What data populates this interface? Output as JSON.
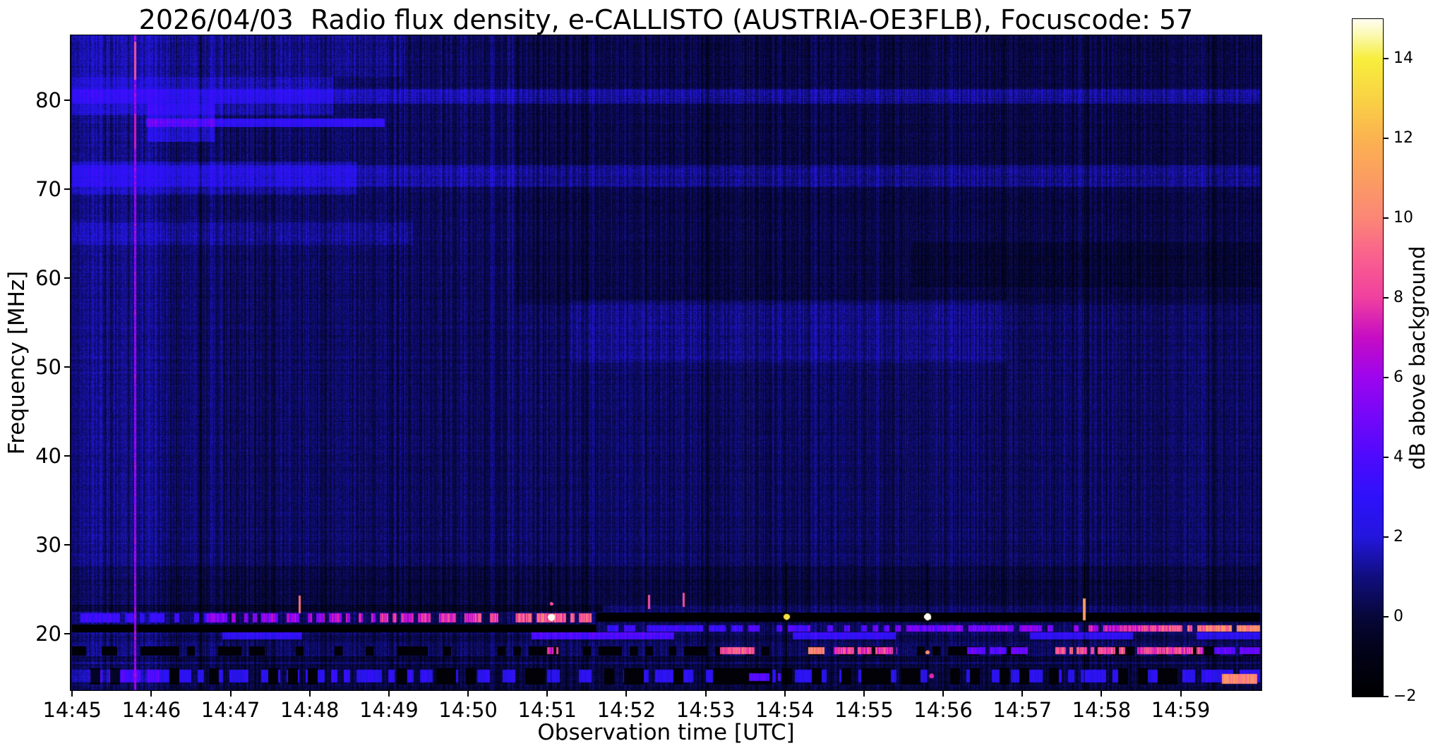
{
  "chart_data": {
    "type": "heatmap",
    "subtype": "radio-spectrogram",
    "title": "2026/04/03  Radio flux density, e-CALLISTO (AUSTRIA-OE3FLB), Focuscode: 57",
    "xlabel": "Observation time [UTC]",
    "ylabel": "Frequency [MHz]",
    "x_ticks": [
      "14:45",
      "14:46",
      "14:47",
      "14:48",
      "14:49",
      "14:50",
      "14:51",
      "14:52",
      "14:53",
      "14:54",
      "14:55",
      "14:56",
      "14:57",
      "14:58",
      "14:59"
    ],
    "x_tick_minutes": [
      0,
      1,
      2,
      3,
      4,
      5,
      6,
      7,
      8,
      9,
      10,
      11,
      12,
      13,
      14
    ],
    "time_range_min": [
      -0.02,
      15.02
    ],
    "y_ticks": [
      20,
      30,
      40,
      50,
      60,
      70,
      80
    ],
    "freq_range_mhz": [
      13.66,
      87.3
    ],
    "grid": false,
    "colorbar": {
      "label": "dB above background",
      "tick_values": [
        14,
        12,
        10,
        8,
        6,
        4,
        2,
        0,
        -2
      ],
      "tick_labels": [
        "14",
        "12",
        "10",
        "8",
        "6",
        "4",
        "2",
        "0",
        "−2"
      ],
      "value_range": [
        -2,
        15
      ],
      "colormap": [
        [
          -2,
          "#000000"
        ],
        [
          -0.7,
          "#03031e"
        ],
        [
          0,
          "#07073a"
        ],
        [
          1,
          "#100e7e"
        ],
        [
          2,
          "#2316dd"
        ],
        [
          3,
          "#2e11fa"
        ],
        [
          4,
          "#4d0afd"
        ],
        [
          5,
          "#7407f9"
        ],
        [
          6,
          "#9d05ee"
        ],
        [
          7,
          "#c50cc4"
        ],
        [
          8,
          "#f0409f"
        ],
        [
          9,
          "#f95f8f"
        ],
        [
          10,
          "#fb8676"
        ],
        [
          11,
          "#fb9d62"
        ],
        [
          12,
          "#fbb250"
        ],
        [
          13,
          "#f9d244"
        ],
        [
          14,
          "#f7ee3c"
        ],
        [
          14.6,
          "#fbf9b0"
        ],
        [
          15,
          "#fffef2"
        ]
      ]
    },
    "noise": {
      "base_db": 0.5,
      "column_jitter": 0.75,
      "pixel_jitter": 0.55,
      "row_jitter": 0.25
    },
    "regions": [
      {
        "t": [
          0,
          15
        ],
        "f": [
          79.6,
          81.3
        ],
        "dv": 1.1
      },
      {
        "t": [
          0,
          3.3
        ],
        "f": [
          78.3,
          82.6
        ],
        "dv": 1.0
      },
      {
        "t": [
          0,
          4.2
        ],
        "f": [
          82.6,
          87.3
        ],
        "dv": 0.45
      },
      {
        "t": [
          0.93,
          3.95
        ],
        "f": [
          77.0,
          77.9
        ],
        "dv": 2.3
      },
      {
        "t": [
          0.95,
          1.8
        ],
        "f": [
          75.3,
          79.6
        ],
        "dv": 1.3
      },
      {
        "t": [
          0,
          15
        ],
        "f": [
          70.2,
          72.7
        ],
        "dv": 0.95
      },
      {
        "t": [
          0,
          3.6
        ],
        "f": [
          69.4,
          73.1
        ],
        "dv": 0.8
      },
      {
        "t": [
          0,
          4.3
        ],
        "f": [
          63.7,
          66.3
        ],
        "dv": 0.55
      },
      {
        "t": [
          5.6,
          15
        ],
        "f": [
          57,
          87.3
        ],
        "dv": -0.4
      },
      {
        "t": [
          10.6,
          15
        ],
        "f": [
          59,
          64
        ],
        "dv": -0.35
      },
      {
        "t": [
          6.3,
          11.8
        ],
        "f": [
          50.5,
          57.5
        ],
        "dv": 0.5
      },
      {
        "t": [
          0,
          15
        ],
        "f": [
          23.2,
          27.6
        ],
        "dv": -0.55
      },
      {
        "t": [
          0,
          15
        ],
        "f": [
          13.66,
          16.6
        ],
        "dv": -0.55
      },
      {
        "t": [
          0,
          15
        ],
        "f": [
          16.8,
          17.45
        ],
        "dv": -0.75
      },
      {
        "t": [
          0,
          1.15
        ],
        "f": [
          13.66,
          87.3
        ],
        "dv": 0.45
      },
      {
        "t": [
          0,
          6.7
        ],
        "f": [
          22.45,
          23.3
        ],
        "dv": -1.1
      },
      {
        "t": [
          0,
          15
        ],
        "f": [
          19.1,
          19.9
        ],
        "dv": -0.35
      }
    ],
    "features": [
      {
        "type": "vline",
        "t": 1.62,
        "f": [
          13.66,
          87.3
        ],
        "add": -0.85,
        "w": 2
      },
      {
        "type": "vline",
        "t": 4.83,
        "f": [
          13.66,
          87.3
        ],
        "add": -0.85,
        "w": 2
      },
      {
        "type": "vline",
        "t": 8.03,
        "f": [
          13.66,
          87.3
        ],
        "add": -0.85,
        "w": 2
      },
      {
        "type": "vline",
        "t": 11.23,
        "f": [
          13.66,
          87.3
        ],
        "add": -0.85,
        "w": 2
      },
      {
        "type": "vline",
        "t": 14.43,
        "f": [
          13.66,
          87.3
        ],
        "add": -0.85,
        "w": 2
      },
      {
        "type": "hband",
        "t": [
          0,
          1.7
        ],
        "f": [
          21.3,
          22.3
        ],
        "v": 3.4,
        "dash": 7,
        "duty": 0.6,
        "jitter": 0.8
      },
      {
        "type": "hband",
        "t": [
          1.7,
          6.6
        ],
        "f": [
          21.3,
          22.3
        ],
        "v": 5,
        "v2": 9.3,
        "dash": 6,
        "duty": 0.68,
        "jitter": 1.6
      },
      {
        "type": "hband",
        "t": [
          6.62,
          15
        ],
        "f": [
          21.35,
          22.35
        ],
        "v": -1.85
      },
      {
        "type": "hband",
        "t": [
          0,
          6.62
        ],
        "f": [
          20.15,
          21.05
        ],
        "v": -1.85
      },
      {
        "type": "hband",
        "t": [
          6.75,
          12.6
        ],
        "f": [
          20.25,
          21.0
        ],
        "v": 3,
        "v2": 5.5,
        "dash": 8,
        "duty": 0.72,
        "jitter": 1.2
      },
      {
        "type": "hband",
        "t": [
          12.6,
          15
        ],
        "f": [
          20.25,
          21.0
        ],
        "v": 6,
        "v2": 10.8,
        "dash": 7,
        "duty": 0.78,
        "jitter": 1.5
      },
      {
        "type": "hband",
        "t": [
          1.9,
          2.9
        ],
        "f": [
          19.4,
          20.15
        ],
        "add": 2.6
      },
      {
        "type": "hband",
        "t": [
          5.8,
          7.6
        ],
        "f": [
          19.4,
          20.15
        ],
        "add": 3.6
      },
      {
        "type": "hband",
        "t": [
          9.1,
          10.4
        ],
        "f": [
          19.4,
          20.15
        ],
        "add": 2.8
      },
      {
        "type": "hband",
        "t": [
          12.1,
          13.4
        ],
        "f": [
          19.4,
          20.15
        ],
        "add": 2.6
      },
      {
        "type": "hband",
        "t": [
          14.2,
          15
        ],
        "f": [
          19.4,
          20.15
        ],
        "add": 2.4
      },
      {
        "type": "hband",
        "t": [
          0,
          15
        ],
        "f": [
          17.55,
          18.55
        ],
        "v": -1.7,
        "dash": 11,
        "duty": 0.5
      },
      {
        "type": "hband",
        "t": [
          6.0,
          6.14
        ],
        "f": [
          17.7,
          18.5
        ],
        "v": 8,
        "dash": 4,
        "duty": 0.9,
        "jitter": 1
      },
      {
        "type": "hband",
        "t": [
          8.15,
          8.62
        ],
        "f": [
          17.7,
          18.5
        ],
        "v": 8.5,
        "dash": 5,
        "duty": 0.85,
        "jitter": 1.4
      },
      {
        "type": "hband",
        "t": [
          9.3,
          9.5
        ],
        "f": [
          17.7,
          18.5
        ],
        "v": 10,
        "dash": 5,
        "duty": 0.85,
        "jitter": 1.2
      },
      {
        "type": "hband",
        "t": [
          9.62,
          10.42
        ],
        "f": [
          17.7,
          18.5
        ],
        "v": 8,
        "dash": 5,
        "duty": 0.8,
        "jitter": 1.4
      },
      {
        "type": "hband",
        "t": [
          11.3,
          12.1
        ],
        "f": [
          17.7,
          18.5
        ],
        "v": 4.5,
        "dash": 6,
        "duty": 0.8,
        "jitter": 1
      },
      {
        "type": "hband",
        "t": [
          12.35,
          13.3
        ],
        "f": [
          17.7,
          18.5
        ],
        "v": 8.6,
        "dash": 5,
        "duty": 0.85,
        "jitter": 1.4
      },
      {
        "type": "hband",
        "t": [
          13.45,
          14.3
        ],
        "f": [
          17.7,
          18.5
        ],
        "v": 8.0,
        "dash": 5,
        "duty": 0.8,
        "jitter": 1.4
      },
      {
        "type": "hband",
        "t": [
          14.4,
          15
        ],
        "f": [
          17.7,
          18.5
        ],
        "v": 4.5,
        "dash": 6,
        "duty": 0.8,
        "jitter": 1
      },
      {
        "type": "hband",
        "t": [
          0,
          15
        ],
        "f": [
          14.55,
          15.95
        ],
        "v": 2.7,
        "dash": 9,
        "duty": 0.6,
        "jitter": 0.8
      },
      {
        "type": "hband",
        "t": [
          0,
          15
        ],
        "f": [
          14.3,
          16.1
        ],
        "v": -1.7,
        "dash": 14,
        "duty": 0.33
      },
      {
        "type": "hband",
        "t": [
          0,
          1.1
        ],
        "f": [
          14.5,
          16.0
        ],
        "add": 1.2
      },
      {
        "type": "hband",
        "t": [
          8.55,
          8.95
        ],
        "f": [
          14.7,
          15.6
        ],
        "v": 4.2,
        "dash": 6,
        "duty": 0.7,
        "jitter": 0.8
      },
      {
        "type": "hband",
        "t": [
          14.52,
          14.97
        ],
        "f": [
          14.35,
          15.45
        ],
        "v": 10.3,
        "dash": 5,
        "duty": 0.9,
        "jitter": 1
      },
      {
        "type": "dot",
        "t": 10.85,
        "f": 15.3,
        "r": 3.5,
        "v": 7.5
      },
      {
        "type": "vline",
        "t": 2.87,
        "f": [
          22.3,
          24.3
        ],
        "v": 9.5,
        "w": 3
      },
      {
        "type": "vline",
        "t": 7.28,
        "f": [
          22.8,
          24.4
        ],
        "v": 8.5,
        "w": 3
      },
      {
        "type": "vline",
        "t": 7.72,
        "f": [
          23.0,
          24.6
        ],
        "v": 8.5,
        "w": 3
      },
      {
        "type": "vline",
        "t": 0.79,
        "f": [
          13.66,
          87.3
        ],
        "v": 6.0,
        "w": 3,
        "jitter": 1.2
      },
      {
        "type": "vline",
        "t": 0.79,
        "f": [
          82.3,
          86.6
        ],
        "v": 8.6,
        "w": 3
      },
      {
        "type": "vline",
        "t": 0.79,
        "f": [
          74.5,
          78.5
        ],
        "v": 7.3,
        "w": 3
      },
      {
        "type": "vline",
        "t": 6.05,
        "f": [
          13.66,
          28
        ],
        "add": -1.6,
        "w": 2
      },
      {
        "type": "vline",
        "t": 9.02,
        "f": [
          13.66,
          28
        ],
        "add": -1.6,
        "w": 2
      },
      {
        "type": "vline",
        "t": 10.8,
        "f": [
          13.66,
          28
        ],
        "add": -1.6,
        "w": 2
      },
      {
        "type": "vline",
        "t": 12.78,
        "f": [
          13.66,
          28
        ],
        "add": -1.3,
        "w": 2
      },
      {
        "type": "vline",
        "t": 12.78,
        "f": [
          21.5,
          24.0
        ],
        "v": 11,
        "w": 4
      },
      {
        "type": "dot",
        "t": 6.05,
        "f": 21.9,
        "r": 5,
        "v": 15
      },
      {
        "type": "dot",
        "t": 6.05,
        "f": 23.4,
        "r": 2.5,
        "v": 8.5
      },
      {
        "type": "dot",
        "t": 9.02,
        "f": 21.95,
        "r": 4.5,
        "v": 13.5
      },
      {
        "type": "dot",
        "t": 10.8,
        "f": 21.95,
        "r": 5,
        "v": 15
      },
      {
        "type": "dot",
        "t": 10.8,
        "f": 17.95,
        "r": 3,
        "v": 10.5
      }
    ]
  }
}
